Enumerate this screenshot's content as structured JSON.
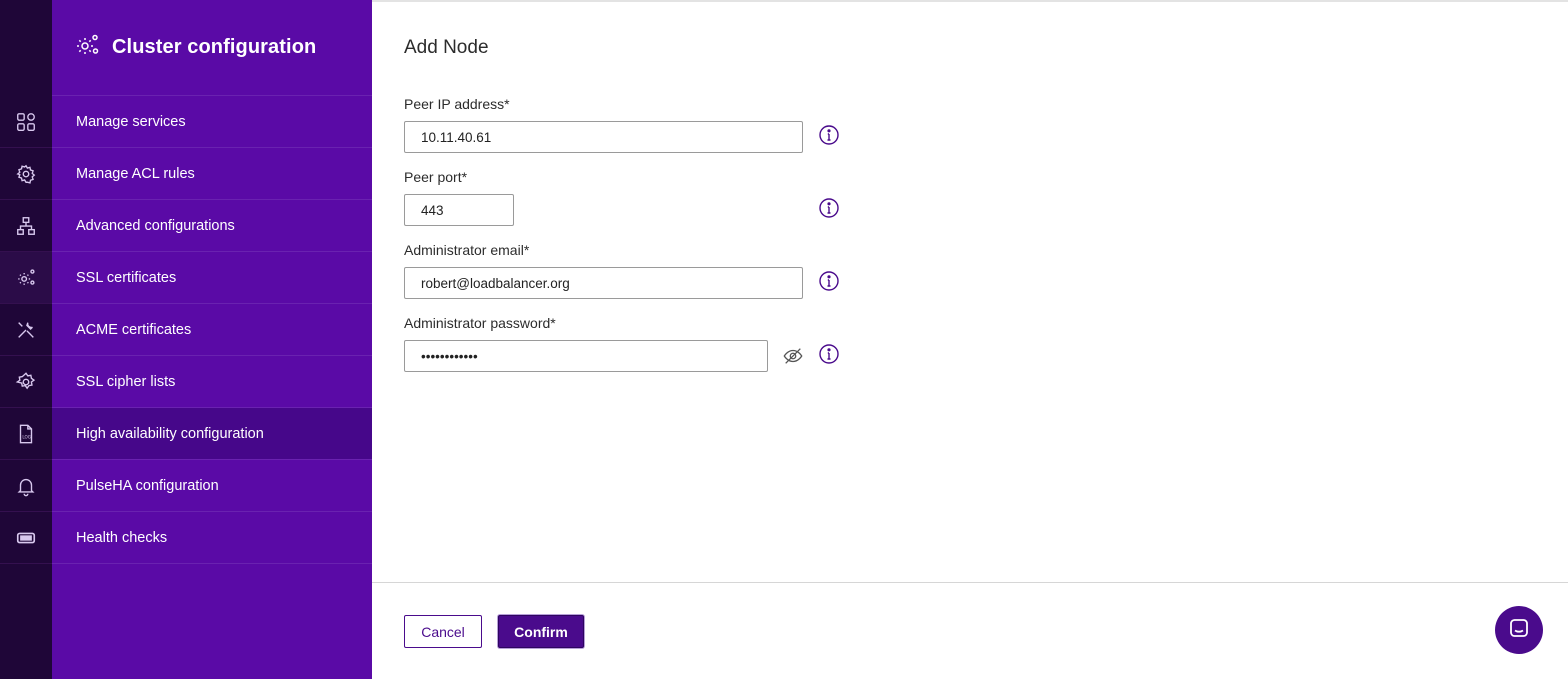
{
  "sidebar": {
    "title": "Cluster configuration",
    "items": [
      {
        "label": "Manage services",
        "icon": "grid-icon"
      },
      {
        "label": "Manage ACL rules",
        "icon": "gear-settings-icon"
      },
      {
        "label": "Advanced configurations",
        "icon": "network-icon"
      },
      {
        "label": "SSL certificates",
        "icon": "gears-icon"
      },
      {
        "label": "ACME certificates",
        "icon": "tools-icon"
      },
      {
        "label": "SSL cipher lists",
        "icon": "gear-icon"
      },
      {
        "label": "High availability configuration",
        "icon": "log-file-icon"
      },
      {
        "label": "PulseHA configuration",
        "icon": "bell-icon"
      },
      {
        "label": "Health checks",
        "icon": "ticket-icon"
      }
    ],
    "active_index": 6
  },
  "form": {
    "title": "Add Node",
    "peer_ip": {
      "label": "Peer IP address*",
      "value": "10.11.40.61"
    },
    "peer_port": {
      "label": "Peer port*",
      "value": "443"
    },
    "admin_email": {
      "label": "Administrator email*",
      "value": "robert@loadbalancer.org"
    },
    "admin_password": {
      "label": "Administrator password*",
      "value": "••••••••••••"
    }
  },
  "actions": {
    "cancel_label": "Cancel",
    "confirm_label": "Confirm"
  },
  "colors": {
    "rail": "#1f0638",
    "sidebar": "#5a0aa6",
    "sidebar_active": "#46078a",
    "accent": "#4a0b8c"
  }
}
